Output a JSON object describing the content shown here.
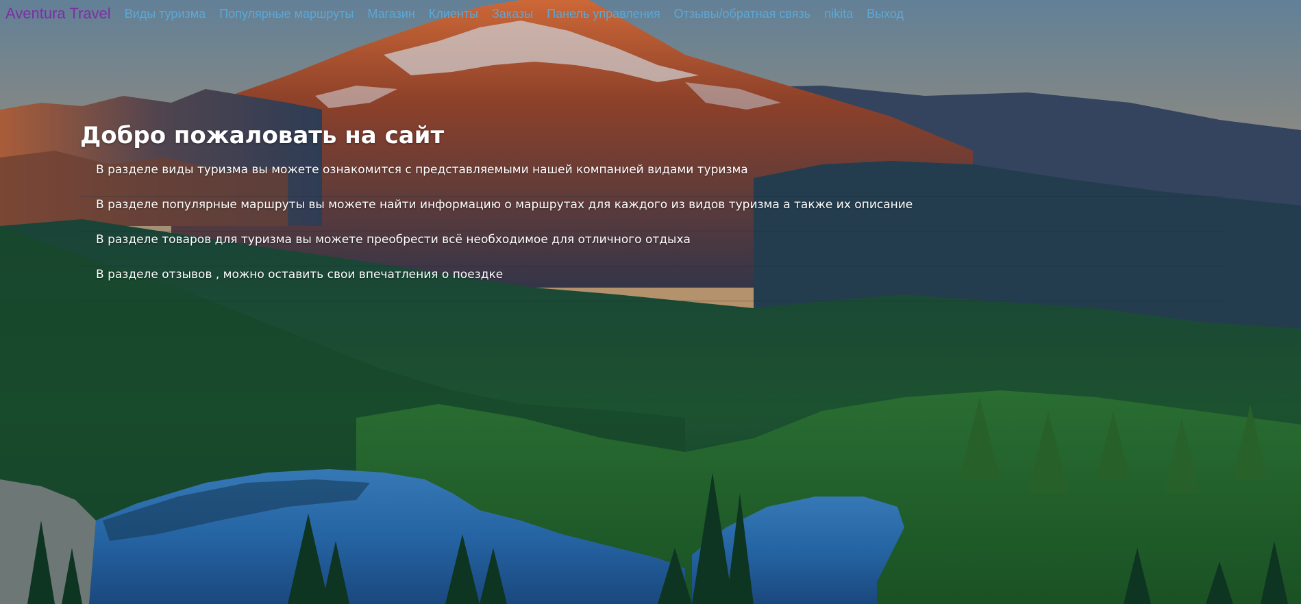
{
  "navbar": {
    "brand": "Aventura Travel",
    "links": [
      {
        "label": "Виды туризма"
      },
      {
        "label": "Популярные маршруты"
      },
      {
        "label": "Магазин"
      },
      {
        "label": "Клиенты"
      },
      {
        "label": "Заказы"
      },
      {
        "label": "Панель управления"
      },
      {
        "label": "Отзывы/обратная связь"
      },
      {
        "label": "nikita"
      },
      {
        "label": "Выход"
      }
    ]
  },
  "main": {
    "title": "Добро пожаловать на сайт",
    "items": [
      "В разделе виды туризма вы можете ознакомится с представляемыми нашей компанией видами туризма",
      "В разделе популярные маршруты вы можете найти информацию о маршрутах для каждого из видов туризма а также их описание",
      "В разделе товаров для туризма вы можете преобрести всё необходимое для отличного отдыха",
      "В разделе отзывов , можно оставить свои впечатления о поездке"
    ]
  },
  "colors": {
    "brand": "#7b2fa6",
    "nav_link": "#5aa8d8",
    "text": "#ffffff"
  },
  "background": {
    "icon": "mountain-lake-landscape"
  }
}
